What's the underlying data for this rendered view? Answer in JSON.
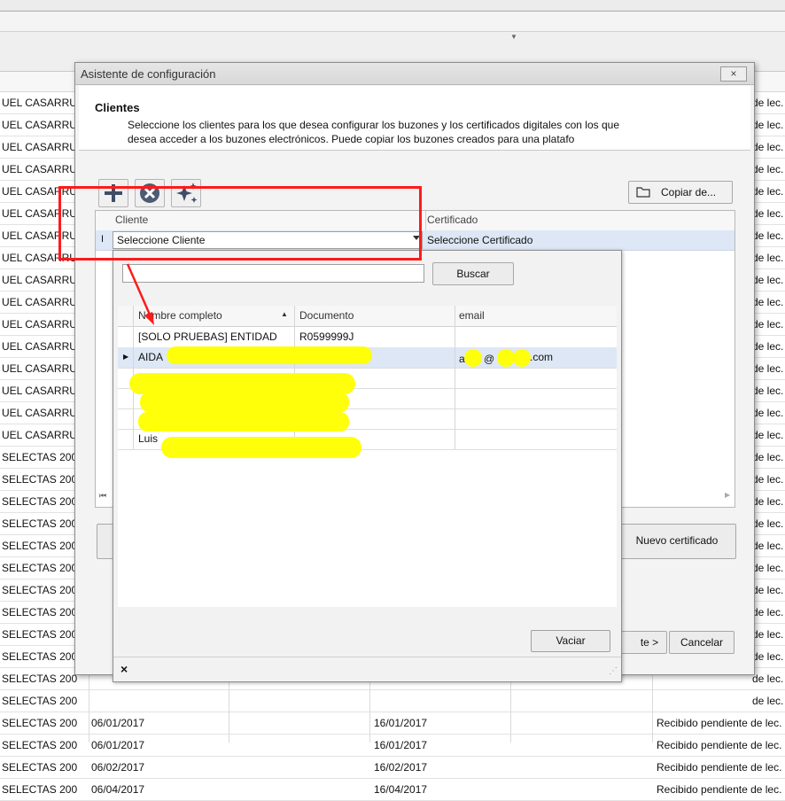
{
  "background": {
    "rows": [
      {
        "c0": "UEL CASARRU",
        "c1": "",
        "c2": "",
        "c3": "",
        "cr": "de lec."
      },
      {
        "c0": "UEL CASARRU",
        "c1": "",
        "c2": "",
        "c3": "",
        "cr": "de lec."
      },
      {
        "c0": "UEL CASARRU",
        "c1": "",
        "c2": "",
        "c3": "",
        "cr": "de lec."
      },
      {
        "c0": "UEL CASARRU",
        "c1": "",
        "c2": "",
        "c3": "",
        "cr": "de lec."
      },
      {
        "c0": "UEL CASARRU",
        "c1": "",
        "c2": "",
        "c3": "",
        "cr": "de lec."
      },
      {
        "c0": "UEL CASARRU",
        "c1": "",
        "c2": "",
        "c3": "",
        "cr": "de lec."
      },
      {
        "c0": "UEL CASARRU",
        "c1": "",
        "c2": "",
        "c3": "",
        "cr": "de lec."
      },
      {
        "c0": "UEL CASARRU",
        "c1": "",
        "c2": "",
        "c3": "",
        "cr": "de lec."
      },
      {
        "c0": "UEL CASARRU",
        "c1": "",
        "c2": "",
        "c3": "",
        "cr": "de lec."
      },
      {
        "c0": "UEL CASARRU",
        "c1": "",
        "c2": "",
        "c3": "",
        "cr": "de lec."
      },
      {
        "c0": "UEL CASARRU",
        "c1": "",
        "c2": "",
        "c3": "",
        "cr": "de lec."
      },
      {
        "c0": "UEL CASARRU",
        "c1": "",
        "c2": "",
        "c3": "",
        "cr": "de lec."
      },
      {
        "c0": "UEL CASARRU",
        "c1": "",
        "c2": "",
        "c3": "",
        "cr": "de lec."
      },
      {
        "c0": "UEL CASARRU",
        "c1": "",
        "c2": "",
        "c3": "",
        "cr": "de lec."
      },
      {
        "c0": "UEL CASARRU",
        "c1": "",
        "c2": "",
        "c3": "",
        "cr": "de lec."
      },
      {
        "c0": "UEL CASARRU",
        "c1": "",
        "c2": "",
        "c3": "",
        "cr": "de lec."
      },
      {
        "c0": "SELECTAS 200",
        "c1": "",
        "c2": "",
        "c3": "",
        "cr": "de lec."
      },
      {
        "c0": "SELECTAS 200",
        "c1": "",
        "c2": "",
        "c3": "",
        "cr": "de lec."
      },
      {
        "c0": "SELECTAS 200",
        "c1": "",
        "c2": "",
        "c3": "",
        "cr": "de lec."
      },
      {
        "c0": "SELECTAS 200",
        "c1": "",
        "c2": "",
        "c3": "",
        "cr": "de lec."
      },
      {
        "c0": "SELECTAS 200",
        "c1": "",
        "c2": "",
        "c3": "",
        "cr": "de lec."
      },
      {
        "c0": "SELECTAS 200",
        "c1": "",
        "c2": "",
        "c3": "",
        "cr": "de lec."
      },
      {
        "c0": "SELECTAS 200",
        "c1": "",
        "c2": "",
        "c3": "",
        "cr": "de lec."
      },
      {
        "c0": "SELECTAS 200",
        "c1": "",
        "c2": "",
        "c3": "",
        "cr": "de lec."
      },
      {
        "c0": "SELECTAS 200",
        "c1": "",
        "c2": "",
        "c3": "",
        "cr": "de lec."
      },
      {
        "c0": "SELECTAS 200",
        "c1": "",
        "c2": "",
        "c3": "",
        "cr": "de lec."
      },
      {
        "c0": "SELECTAS 200",
        "c1": "",
        "c2": "",
        "c3": "",
        "cr": "de lec."
      },
      {
        "c0": "SELECTAS 200",
        "c1": "",
        "c2": "",
        "c3": "",
        "cr": "de lec."
      },
      {
        "c0": "SELECTAS 200...",
        "c1": "06/01/2017",
        "c2": "16/01/2017",
        "c3": "Recibido pendiente de lec.",
        "cr": ""
      },
      {
        "c0": "SELECTAS 200...",
        "c1": "06/01/2017",
        "c2": "16/01/2017",
        "c3": "Recibido pendiente de lec.",
        "cr": ""
      },
      {
        "c0": "SELECTAS 200...",
        "c1": "06/02/2017",
        "c2": "16/02/2017",
        "c3": "Recibido pendiente de lec.",
        "cr": ""
      },
      {
        "c0": "SELECTAS 200",
        "c1": "06/04/2017",
        "c2": "16/04/2017",
        "c3": "Recibido pendiente de lec.",
        "cr": ""
      }
    ]
  },
  "dialog": {
    "title": "Asistente de configuración",
    "close_glyph": "×",
    "header_title": "Clientes",
    "header_desc_line1": "Seleccione los clientes para los que desea configurar los buzones y los certificados digitales con los que",
    "header_desc_line2": "desea acceder a los buzones electrónicos. Puede copiar los buzones creados para una platafo",
    "copy_button": "Copiar de...",
    "grid": {
      "col_cliente": "Cliente",
      "col_certificado": "Certificado",
      "row_cursor": "I",
      "cliente_value": "Seleccione Cliente",
      "certificado_value": "Seleccione Certificado",
      "nav_first": "⏮"
    },
    "nuevo_certificado_button": "Nuevo certificado",
    "next_button": "te >",
    "cancel_button": "Cancelar"
  },
  "popup": {
    "search_value": "",
    "search_button": "Buscar",
    "columns": {
      "name": "Nombre completo",
      "doc": "Documento",
      "email": "email"
    },
    "sort_glyph": "▲",
    "rows": [
      {
        "name": "[SOLO PRUEBAS] ENTIDAD",
        "doc": "R0599999J",
        "email": "",
        "ind": ""
      },
      {
        "name": "AIDA",
        "doc": "",
        "email": ".com",
        "ind": "▶"
      },
      {
        "name": "",
        "doc": "5",
        "email": "",
        "ind": ""
      },
      {
        "name": "",
        "doc": "",
        "email": "",
        "ind": ""
      },
      {
        "name": "",
        "doc": "7",
        "email": "",
        "ind": ""
      },
      {
        "name": "Luis",
        "doc": "",
        "email": "",
        "ind": ""
      }
    ],
    "email_partial": "a",
    "email_at": "@",
    "vaciar_button": "Vaciar",
    "close_glyph": "×",
    "grip_glyph": "⋰"
  },
  "colors": {
    "annotation_red": "#ff1a1a",
    "redaction_yellow": "#ffff0a",
    "selection_blue": "#dde7f5"
  }
}
